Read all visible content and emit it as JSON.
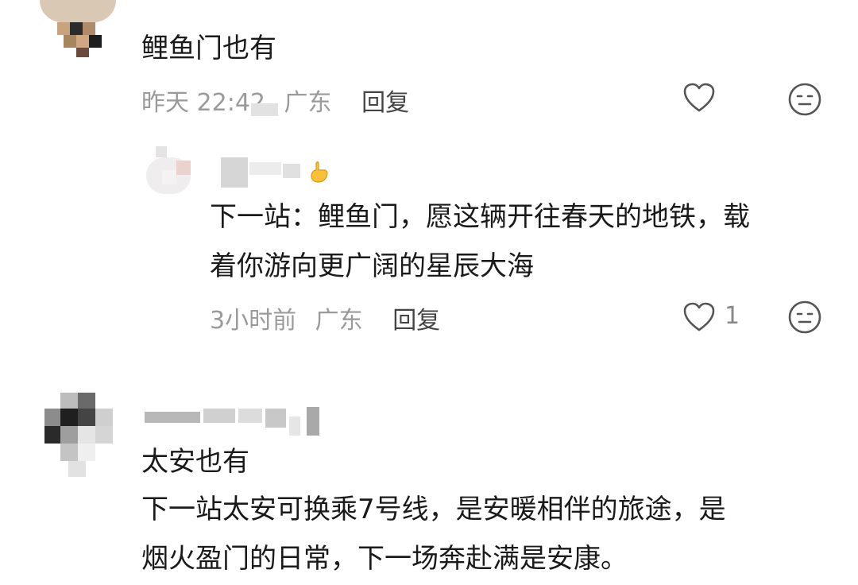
{
  "comments": [
    {
      "text": "鲤鱼门也有",
      "time": "昨天 22:42",
      "location": "广东",
      "reply_label": "回复",
      "like_count": ""
    },
    {
      "text_lines": [
        "下一站：鲤鱼门，愿这辆开往春天的地铁，载",
        "着你游向更广阔的星辰大海"
      ],
      "time": "3小时前",
      "location": "广东",
      "reply_label": "回复",
      "like_count": "1"
    },
    {
      "text_lines": [
        "太安也有",
        "下一站太安可换乘7号线，是安暖相伴的旅途，是",
        "烟火盈门的日常，下一场奔赴满是安康。"
      ]
    }
  ],
  "colors": {
    "text": "#1a1a1a",
    "meta": "#9a9a9a",
    "reply": "#444444",
    "icon": "#555555"
  },
  "icons": {
    "like": "heart-outline-icon",
    "emoji": "emoji-face-icon"
  }
}
